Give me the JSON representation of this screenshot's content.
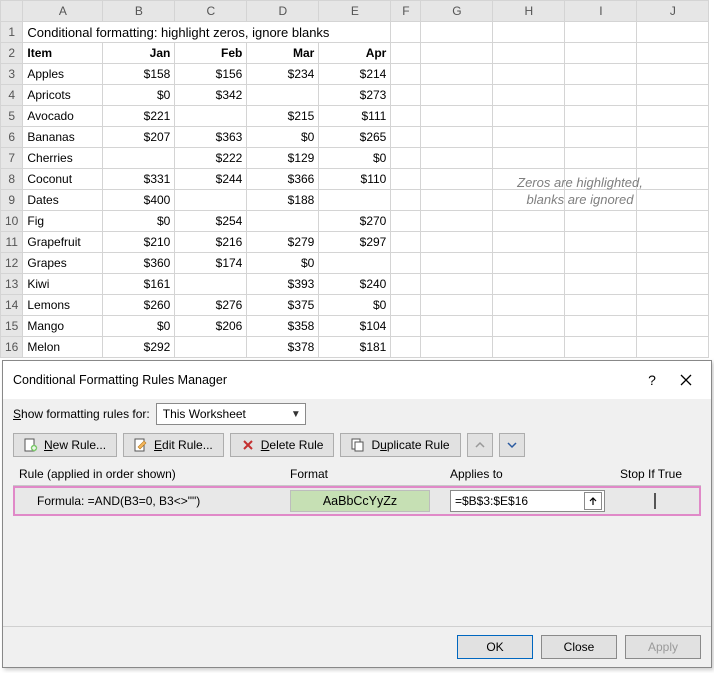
{
  "title_cell": "Conditional formatting: highlight zeros, ignore blanks",
  "col_letters": [
    "A",
    "B",
    "C",
    "D",
    "E",
    "F",
    "G",
    "H",
    "I",
    "J"
  ],
  "headers": {
    "item": "Item",
    "m1": "Jan",
    "m2": "Feb",
    "m3": "Mar",
    "m4": "Apr"
  },
  "rows": [
    {
      "n": 3,
      "item": "Apples",
      "v": [
        "$158",
        "$156",
        "$234",
        "$214"
      ],
      "z": [
        0,
        0,
        0,
        0
      ]
    },
    {
      "n": 4,
      "item": "Apricots",
      "v": [
        "$0",
        "$342",
        "",
        "$273"
      ],
      "z": [
        1,
        0,
        0,
        0
      ]
    },
    {
      "n": 5,
      "item": "Avocado",
      "v": [
        "$221",
        "",
        "$215",
        "$111"
      ],
      "z": [
        0,
        0,
        0,
        0
      ]
    },
    {
      "n": 6,
      "item": "Bananas",
      "v": [
        "$207",
        "$363",
        "$0",
        "$265"
      ],
      "z": [
        0,
        0,
        1,
        0
      ]
    },
    {
      "n": 7,
      "item": "Cherries",
      "v": [
        "",
        "$222",
        "$129",
        "$0"
      ],
      "z": [
        0,
        0,
        0,
        1
      ]
    },
    {
      "n": 8,
      "item": "Coconut",
      "v": [
        "$331",
        "$244",
        "$366",
        "$110"
      ],
      "z": [
        0,
        0,
        0,
        0
      ]
    },
    {
      "n": 9,
      "item": "Dates",
      "v": [
        "$400",
        "",
        "$188",
        ""
      ],
      "z": [
        0,
        0,
        0,
        0
      ]
    },
    {
      "n": 10,
      "item": "Fig",
      "v": [
        "$0",
        "$254",
        "",
        "$270"
      ],
      "z": [
        1,
        0,
        0,
        0
      ]
    },
    {
      "n": 11,
      "item": "Grapefruit",
      "v": [
        "$210",
        "$216",
        "$279",
        "$297"
      ],
      "z": [
        0,
        0,
        0,
        0
      ]
    },
    {
      "n": 12,
      "item": "Grapes",
      "v": [
        "$360",
        "$174",
        "$0",
        ""
      ],
      "z": [
        0,
        0,
        1,
        0
      ]
    },
    {
      "n": 13,
      "item": "Kiwi",
      "v": [
        "$161",
        "",
        "$393",
        "$240"
      ],
      "z": [
        0,
        0,
        0,
        0
      ]
    },
    {
      "n": 14,
      "item": "Lemons",
      "v": [
        "$260",
        "$276",
        "$375",
        "$0"
      ],
      "z": [
        0,
        0,
        0,
        1
      ]
    },
    {
      "n": 15,
      "item": "Mango",
      "v": [
        "$0",
        "$206",
        "$358",
        "$104"
      ],
      "z": [
        1,
        0,
        0,
        0
      ]
    },
    {
      "n": 16,
      "item": "Melon",
      "v": [
        "$292",
        "",
        "$378",
        "$181"
      ],
      "z": [
        0,
        0,
        0,
        0
      ]
    }
  ],
  "note_line1": "Zeros are highlighted,",
  "note_line2": "blanks are ignored",
  "dialog": {
    "title": "Conditional Formatting Rules Manager",
    "show_label": "Show formatting rules for:",
    "show_value": "This Worksheet",
    "btn_new": "New Rule...",
    "btn_edit": "Edit Rule...",
    "btn_delete": "Delete Rule",
    "btn_duplicate": "Duplicate Rule",
    "col_rule": "Rule (applied in order shown)",
    "col_format": "Format",
    "col_applies": "Applies to",
    "col_stop": "Stop If True",
    "rule_text": "Formula: =AND(B3=0, B3<>\"\")",
    "preview_text": "AaBbCcYyZz",
    "applies_value": "=$B$3:$E$16",
    "ok": "OK",
    "close": "Close",
    "apply": "Apply"
  }
}
